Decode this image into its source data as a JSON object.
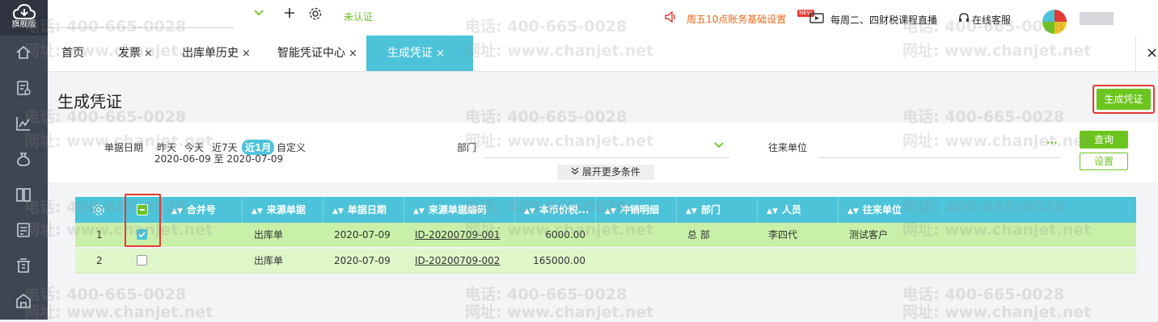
{
  "brand": {
    "label": "旗舰版"
  },
  "sidebar": {
    "icons": [
      "home-icon",
      "invoice-icon",
      "chart-icon",
      "money-bag-icon",
      "ledger-icon",
      "voucher-icon",
      "building-icon",
      "warehouse-icon"
    ]
  },
  "header": {
    "status": "未认证",
    "notice": "周五10点账务基础设置",
    "new_badge": "NEW",
    "live": "每周二、四财税课程直播",
    "service": "在线客服"
  },
  "tabs": [
    {
      "label": "首页"
    },
    {
      "label": "发票"
    },
    {
      "label": "出库单历史"
    },
    {
      "label": "智能凭证中心"
    },
    {
      "label": "生成凭证"
    }
  ],
  "close_symbol": "×",
  "page": {
    "title": "生成凭证",
    "generate_button": "生成凭证"
  },
  "filter": {
    "date_label": "单据日期",
    "quick": [
      "昨天",
      "今天",
      "近7天",
      "近1月",
      "自定义"
    ],
    "selected_quick": "近1月",
    "range": "2020-06-09 至 2020-07-09",
    "dept_label": "部门",
    "partner_label": "往来单位",
    "partner_more": "···",
    "query_button": "查询",
    "settings_button": "设置",
    "expand": "展开更多条件"
  },
  "table": {
    "headers": [
      "合并号",
      "来源单据",
      "单据日期",
      "来源单据编码",
      "本币价税...",
      "冲销明细",
      "部门",
      "人员",
      "往来单位"
    ],
    "rows": [
      {
        "index": "1",
        "checked": true,
        "merge": "",
        "source": "出库单",
        "date": "2020-07-09",
        "code": "ID-20200709-001",
        "amount": "6000.00",
        "reversal": "",
        "dept": "总 部",
        "person": "李四代",
        "partner": "测试客户"
      },
      {
        "index": "2",
        "checked": false,
        "merge": "",
        "source": "出库单",
        "date": "2020-07-09",
        "code": "ID-20200709-002",
        "amount": "165000.00",
        "reversal": "",
        "dept": "",
        "person": "",
        "partner": ""
      }
    ]
  },
  "watermark": {
    "phone": "电话: 400-665-0028",
    "site": "网址: www.chanjet.net"
  },
  "colors": {
    "accent": "#4dc3d9",
    "green": "#6cc51f",
    "highlight": "#e53935",
    "row_bg": "#c9f0a8",
    "sidebar": "#3f4552"
  }
}
